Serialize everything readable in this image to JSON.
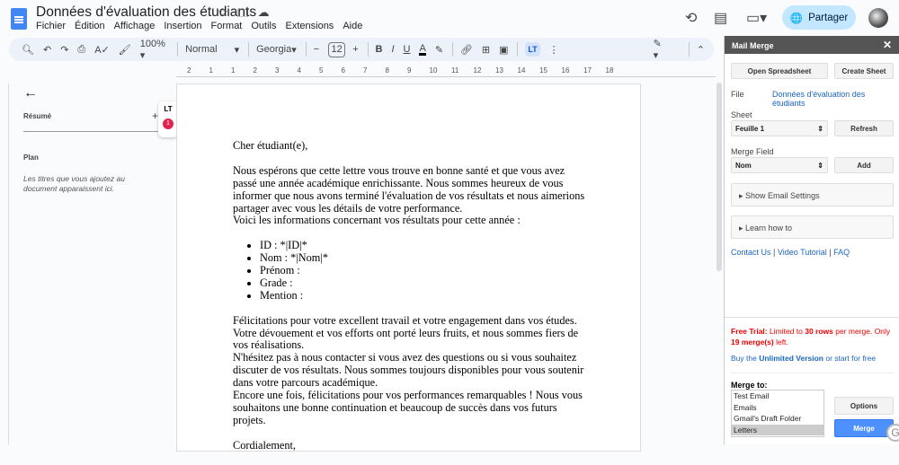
{
  "doc": {
    "title": "Données d'évaluation des étudiants",
    "menu": [
      "Fichier",
      "Édition",
      "Affichage",
      "Insertion",
      "Format",
      "Outils",
      "Extensions",
      "Aide"
    ],
    "share": "Partager"
  },
  "toolbar": {
    "zoom": "100%",
    "style": "Normal",
    "font": "Georgia",
    "size": "12",
    "minus": "−",
    "plus": "+",
    "bold": "B",
    "italic": "I",
    "underline": "U",
    "color": "A"
  },
  "ruler": [
    "2",
    "1",
    "1",
    "2",
    "3",
    "4",
    "5",
    "6",
    "7",
    "8",
    "9",
    "10",
    "11",
    "12",
    "13",
    "14",
    "15",
    "16",
    "17",
    "18"
  ],
  "outline": {
    "summary": "Résumé",
    "plan": "Plan",
    "hint": "Les titres que vous ajoutez au document apparaissent ici.",
    "badge": "1"
  },
  "letter": {
    "greeting": "Cher étudiant(e),",
    "p1": "Nous espérons que cette lettre vous trouve en bonne santé et que vous avez passé une année académique enrichissante. Nous sommes heureux de vous informer que nous avons terminé l'évaluation de vos résultats et nous aimerions partager avec vous les détails de votre performance.",
    "p1b": "Voici les informations concernant vos résultats pour cette année :",
    "bullets": [
      "ID : *|ID|*",
      "Nom : *|Nom|*",
      "Prénom :",
      "Grade :",
      "Mention :"
    ],
    "p2": "Félicitations pour votre excellent travail et votre engagement dans vos études. Votre dévouement et vos efforts ont porté leurs fruits, et nous sommes fiers de vos réalisations.",
    "p3": "N'hésitez pas à nous contacter si vous avez des questions ou si vous souhaitez discuter de vos résultats. Nous sommes toujours disponibles pour vous soutenir dans votre parcours académique.",
    "p4": "Encore une fois, félicitations pour vos performances remarquables ! Nous vous souhaitons une bonne continuation et beaucoup de succès dans vos futurs projets.",
    "closing": "Cordialement,"
  },
  "panel": {
    "title": "Mail Merge",
    "open": "Open Spreadsheet",
    "create": "Create Sheet",
    "file_label": "File",
    "file_value": "Données d'évaluation des étudiants",
    "sheet_label": "Sheet",
    "sheet_value": "Feuille 1",
    "refresh": "Refresh",
    "field_label": "Merge Field",
    "field_value": "Nom",
    "add": "Add",
    "email_settings": "Show Email Settings",
    "learn": "Learn how to",
    "contact": "Contact Us",
    "video": "Video Tutorial",
    "faq": "FAQ",
    "trial": {
      "a": "Free Trial:",
      "b": " Limited to ",
      "c": "30 rows",
      "d": " per merge. Only ",
      "e": "19 merge(s)",
      "f": " left."
    },
    "buy": {
      "a": "Buy the ",
      "b": "Unlimited Version",
      "c": " or start for free"
    },
    "merge_to": "Merge to:",
    "options_list": [
      "Test Email",
      "Emails",
      "Gmail's Draft Folder",
      "Letters"
    ],
    "options": "Options",
    "merge": "Merge"
  }
}
